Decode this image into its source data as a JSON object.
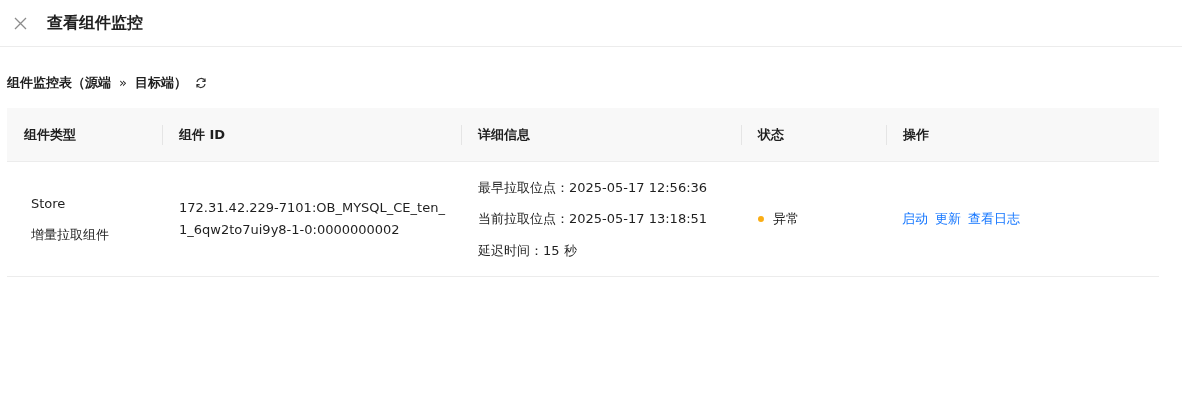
{
  "header": {
    "title": "查看组件监控"
  },
  "section": {
    "source": "组件监控表（源端",
    "separator": "»",
    "target": "目标端）"
  },
  "table": {
    "columns": [
      "组件类型",
      "组件 ID",
      "详细信息",
      "状态",
      "操作"
    ],
    "rows": [
      {
        "type": "Store",
        "subtype": "增量拉取组件",
        "id": "172.31.42.229-7101:OB_MYSQL_CE_ten_1_6qw2to7ui9y8-1-0:0000000002",
        "details": [
          "最早拉取位点：2025-05-17 12:56:36",
          "当前拉取位点：2025-05-17 13:18:51",
          "延迟时间：15 秒"
        ],
        "status": {
          "label": "异常",
          "color": "#faad14"
        },
        "actions": [
          "启动",
          "更新",
          "查看日志"
        ]
      }
    ]
  }
}
